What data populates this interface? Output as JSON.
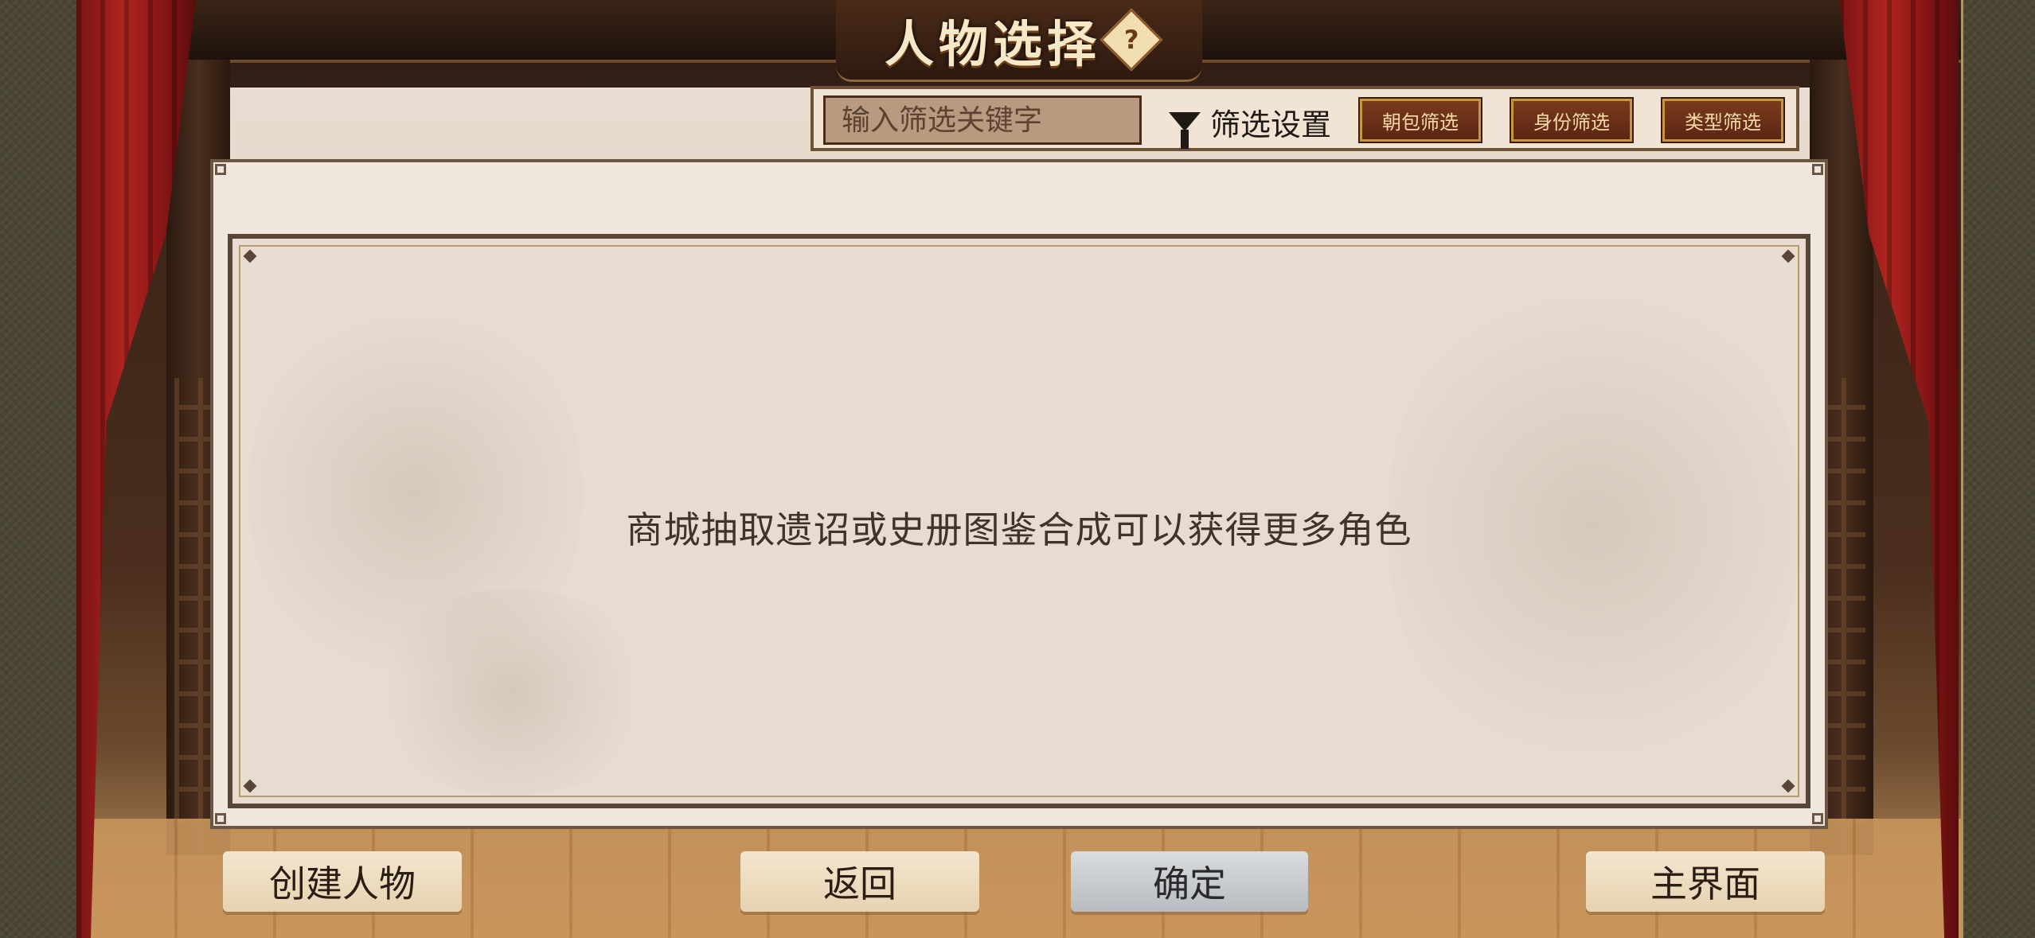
{
  "header": {
    "title": "人物选择",
    "help_symbol": "?"
  },
  "filter_bar": {
    "search_placeholder": "输入筛选关键字",
    "settings_label": "筛选设置",
    "buttons": [
      {
        "label": "朝包筛选"
      },
      {
        "label": "身份筛选"
      },
      {
        "label": "类型筛选"
      }
    ]
  },
  "panel": {
    "empty_hint": "商城抽取遗诏或史册图鉴合成可以获得更多角色"
  },
  "bottom_bar": {
    "create_label": "创建人物",
    "back_label": "返回",
    "confirm_label": "确定",
    "home_label": "主界面"
  },
  "colors": {
    "panel_bg": "#efe6de",
    "filter_button_bg": "#6a2e16",
    "curtain_red": "#b0241f",
    "confirm_disabled": "#b7bcc2"
  },
  "icons": {
    "help": "help-icon",
    "filter": "funnel-icon"
  }
}
